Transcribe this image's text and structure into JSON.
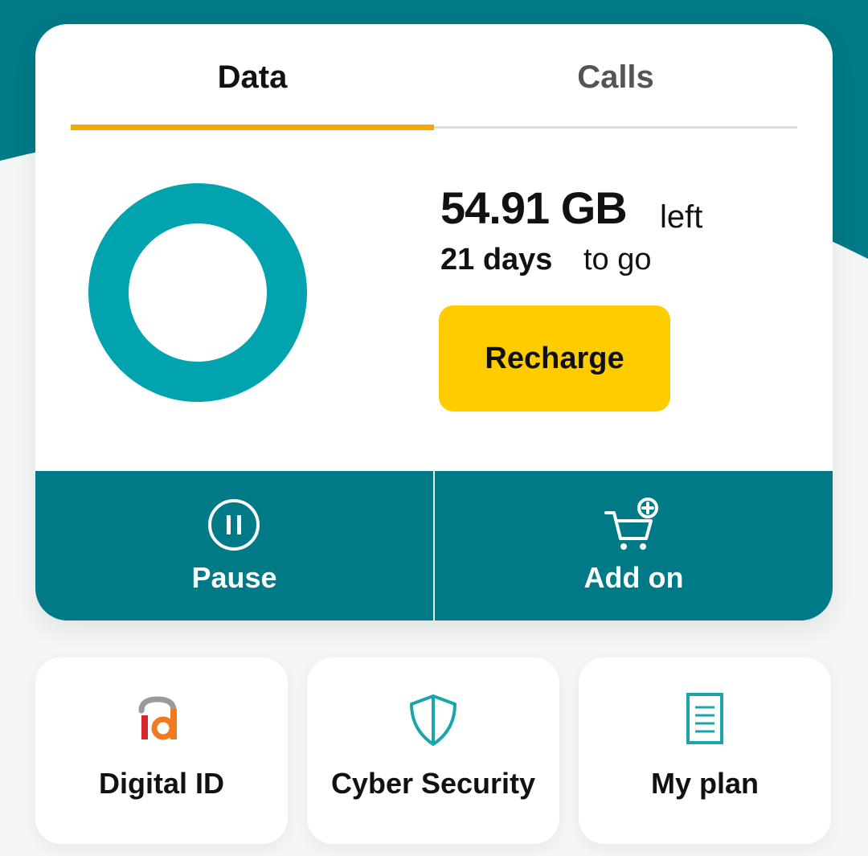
{
  "tabs": [
    {
      "label": "Data",
      "active": true
    },
    {
      "label": "Calls",
      "active": false
    }
  ],
  "usage": {
    "amount": "54.91 GB",
    "amount_suffix": "left",
    "days": "21 days",
    "days_suffix": "to go",
    "remaining_fraction": 1.0
  },
  "recharge_label": "Recharge",
  "actions": [
    {
      "label": "Pause",
      "icon": "pause-circle-icon"
    },
    {
      "label": "Add on",
      "icon": "cart-add-icon"
    }
  ],
  "tiles": [
    {
      "label": "Digital ID",
      "icon": "digital-id-logo-icon"
    },
    {
      "label": "Cyber Security",
      "icon": "shield-icon"
    },
    {
      "label": "My plan",
      "icon": "document-icon"
    }
  ],
  "colors": {
    "teal": "#007a86",
    "donut": "#00a3ae",
    "tab_underline": "#f5a800",
    "recharge": "#ffcc00",
    "background": "#f4f6f6"
  }
}
